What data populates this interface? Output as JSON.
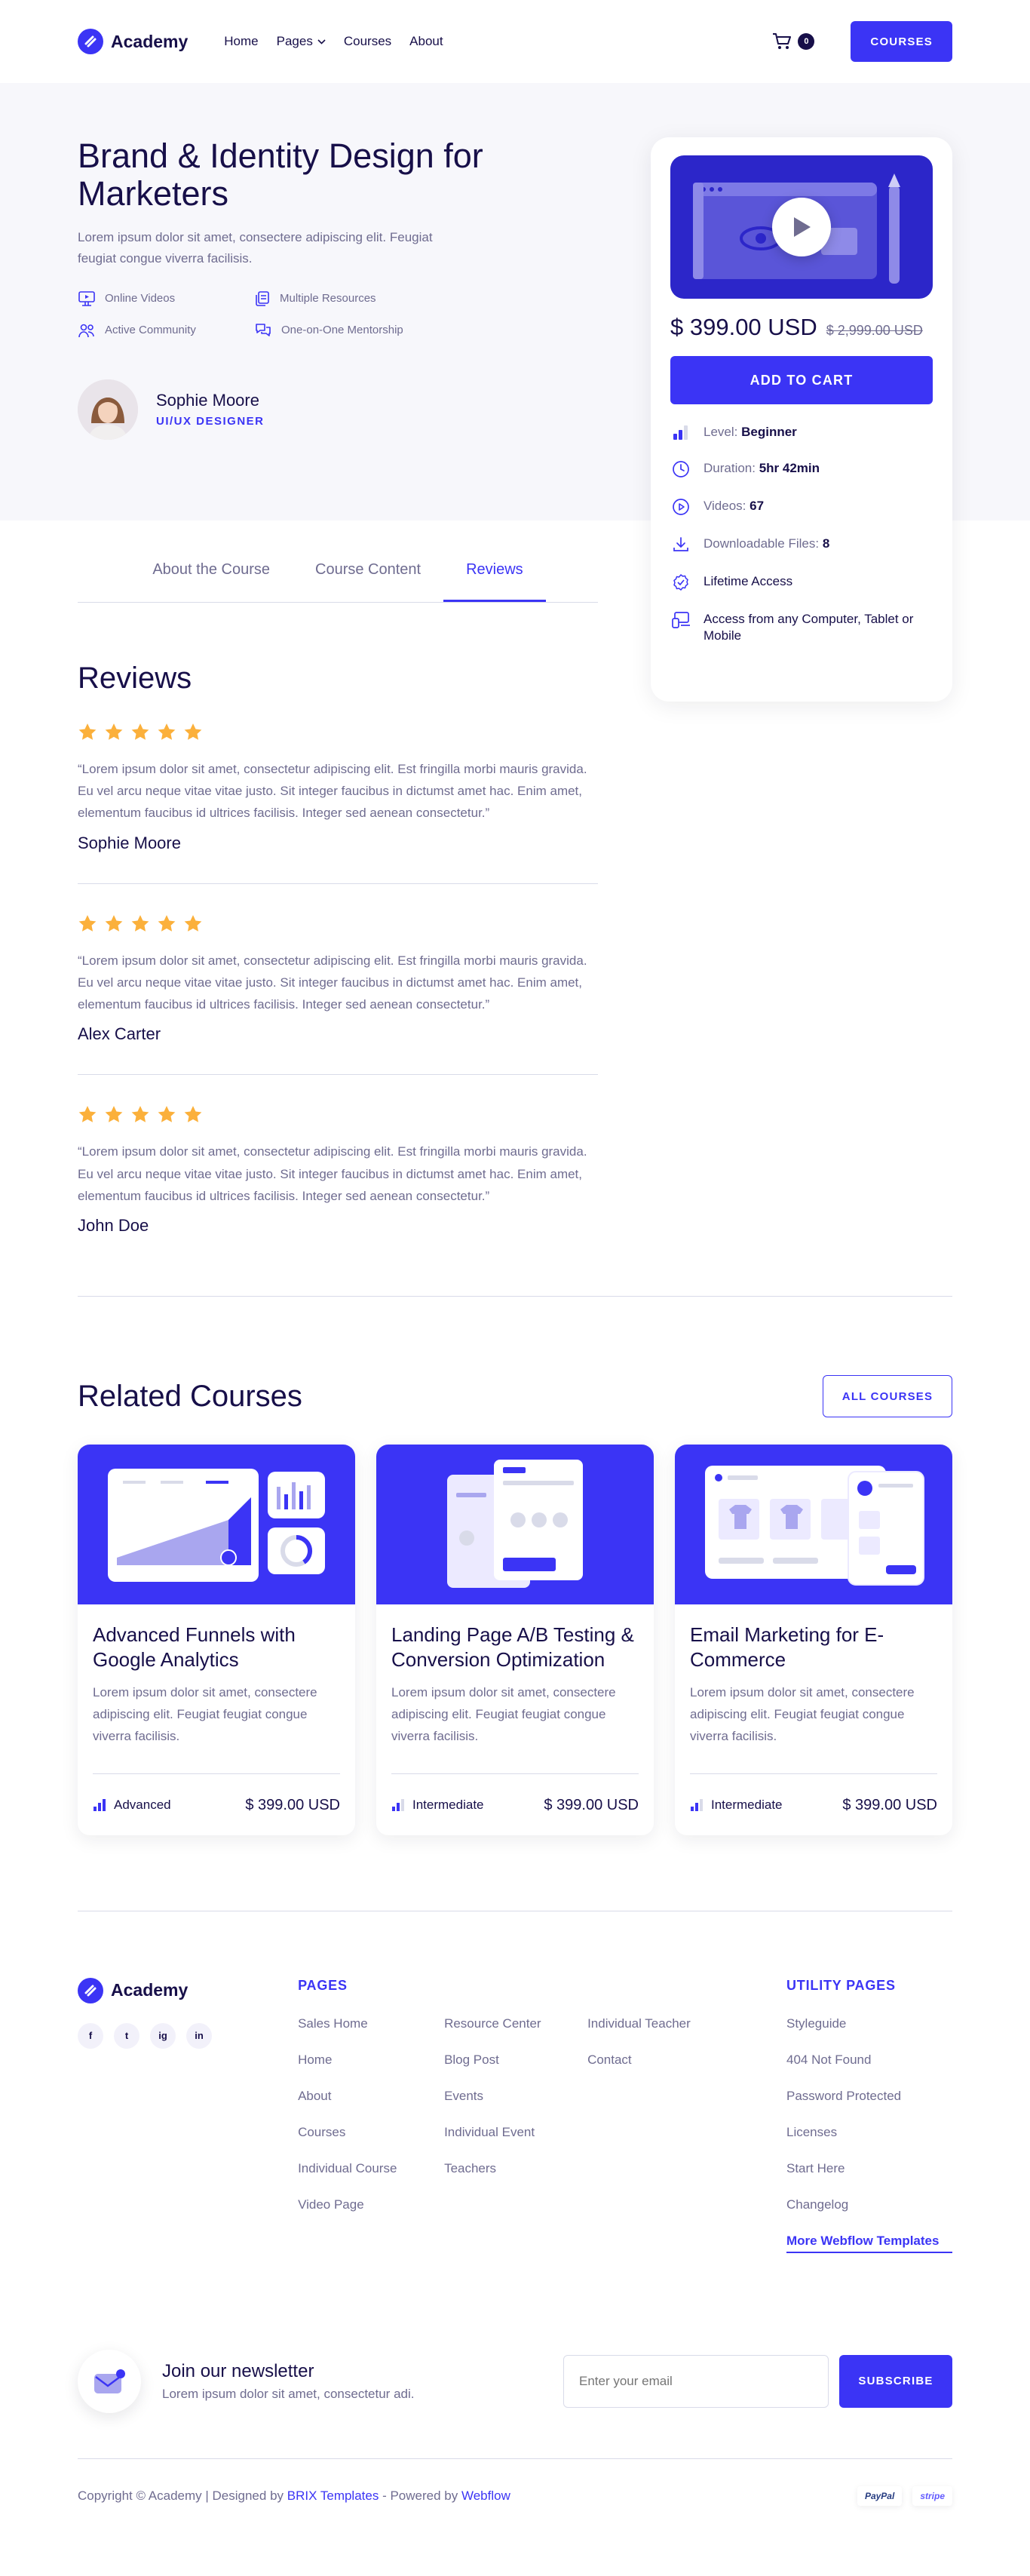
{
  "header": {
    "logo": "Academy",
    "nav": [
      "Home",
      "Pages",
      "Courses",
      "About"
    ],
    "cart_count": "0",
    "cta": "COURSES"
  },
  "hero": {
    "title": "Brand & Identity Design for Marketers",
    "description": "Lorem ipsum dolor sit amet, consectere adipiscing elit. Feugiat feugiat congue viverra facilisis.",
    "features": [
      "Online Videos",
      "Multiple Resources",
      "Active Community",
      "One-on-One Mentorship"
    ],
    "author_name": "Sophie Moore",
    "author_role": "UI/UX DESIGNER"
  },
  "course_card": {
    "price": "$ 399.00 USD",
    "old_price": "$ 2,999.00 USD",
    "add_to_cart": "ADD TO CART",
    "level_label": "Level:",
    "level_value": "Beginner",
    "duration_label": "Duration:",
    "duration_value": "5hr 42min",
    "videos_label": "Videos:",
    "videos_value": "67",
    "files_label": "Downloadable Files:",
    "files_value": "8",
    "lifetime": "Lifetime Access",
    "access": "Access from any Computer, Tablet or Mobile"
  },
  "tabs": [
    "About the Course",
    "Course Content",
    "Reviews"
  ],
  "active_tab": "Reviews",
  "reviews": {
    "title": "Reviews",
    "items": [
      {
        "text": "“Lorem ipsum dolor sit amet, consectetur adipiscing elit. Est fringilla morbi mauris gravida. Eu vel arcu neque vitae vitae justo. Sit integer faucibus in dictumst amet hac. Enim amet, elementum faucibus id ultrices facilisis. Integer sed aenean consectetur.”",
        "name": "Sophie Moore",
        "rating": 5
      },
      {
        "text": "“Lorem ipsum dolor sit amet, consectetur adipiscing elit. Est fringilla morbi mauris gravida. Eu vel arcu neque vitae vitae justo. Sit integer faucibus in dictumst amet hac. Enim amet, elementum faucibus id ultrices facilisis. Integer sed aenean consectetur.”",
        "name": "Alex Carter",
        "rating": 5
      },
      {
        "text": "“Lorem ipsum dolor sit amet, consectetur adipiscing elit. Est fringilla morbi mauris gravida. Eu vel arcu neque vitae vitae justo. Sit integer faucibus in dictumst amet hac. Enim amet, elementum faucibus id ultrices facilisis. Integer sed aenean consectetur.”",
        "name": "John Doe",
        "rating": 5
      }
    ]
  },
  "related": {
    "title": "Related Courses",
    "all_button": "ALL COURSES",
    "courses": [
      {
        "title": "Advanced Funnels with Google Analytics",
        "desc": "Lorem ipsum dolor sit amet, consectere adipiscing elit. Feugiat feugiat congue viverra facilisis.",
        "level": "Advanced",
        "price": "$ 399.00 USD"
      },
      {
        "title": "Landing Page A/B Testing & Conversion Optimization",
        "desc": "Lorem ipsum dolor sit amet, consectere adipiscing elit. Feugiat feugiat congue viverra facilisis.",
        "level": "Intermediate",
        "price": "$ 399.00 USD"
      },
      {
        "title": "Email Marketing for E-Commerce",
        "desc": "Lorem ipsum dolor sit amet, consectere adipiscing elit. Feugiat feugiat congue viverra facilisis.",
        "level": "Intermediate",
        "price": "$ 399.00 USD"
      }
    ]
  },
  "footer": {
    "logo": "Academy",
    "socials": [
      "f",
      "t",
      "ig",
      "in"
    ],
    "pages_title": "PAGES",
    "pages": [
      "Sales Home",
      "Resource Center",
      "Individual Teacher",
      "Home",
      "Blog Post",
      "Contact",
      "About",
      "Events",
      "",
      "Courses",
      "Individual Event",
      "",
      "Individual Course",
      "Teachers",
      "",
      "Video Page",
      "",
      ""
    ],
    "utility_title": "UTILITY PAGES",
    "utility": [
      "Styleguide",
      "404 Not Found",
      "Password Protected",
      "Licenses",
      "Start Here",
      "Changelog"
    ],
    "more_templates": "More Webflow Templates"
  },
  "newsletter": {
    "title": "Join our newsletter",
    "subtitle": "Lorem ipsum dolor sit amet, consectetur adi.",
    "placeholder": "Enter your email",
    "button": "SUBSCRIBE"
  },
  "copyright": {
    "prefix": "Copyright © Academy | Designed by",
    "brix": "BRIX Templates",
    "powered": "- Powered by",
    "webflow": "Webflow",
    "payments": [
      "PayPal",
      "stripe"
    ]
  },
  "colors": {
    "accent": "#3b34f5",
    "heading": "#170f49",
    "body": "#6f6c90",
    "star": "#fbb03b"
  }
}
